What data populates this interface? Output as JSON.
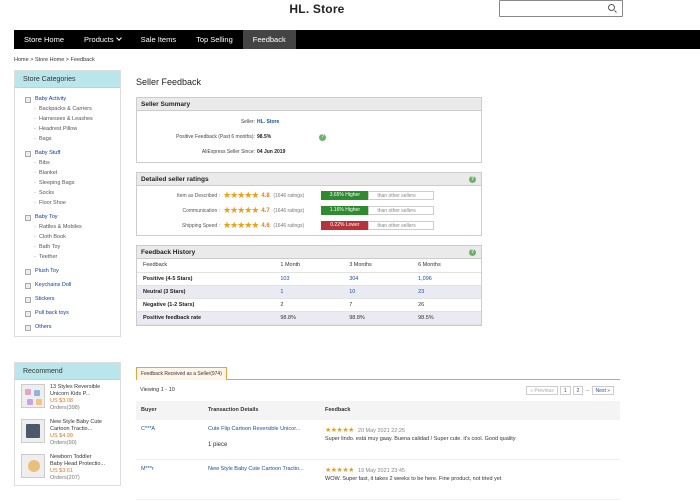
{
  "store": {
    "name": "HL. Store"
  },
  "search": {
    "placeholder": ""
  },
  "nav": {
    "items": [
      "Store Home",
      "Products",
      "Sale Items",
      "Top Selling",
      "Feedback"
    ]
  },
  "breadcrumb": "Home > Store Home > Feedback",
  "sidebar": {
    "title": "Store Categories",
    "items": [
      {
        "label": "Baby Activity",
        "level": "top"
      },
      {
        "label": "Backpacks & Carriers",
        "level": "sub"
      },
      {
        "label": "Harnesses & Leashes",
        "level": "sub"
      },
      {
        "label": "Headrest Pillow",
        "level": "sub"
      },
      {
        "label": "Bags",
        "level": "sub"
      },
      {
        "label": "Baby Stuff",
        "level": "top"
      },
      {
        "label": "Bibs",
        "level": "sub"
      },
      {
        "label": "Blanket",
        "level": "sub"
      },
      {
        "label": "Sleeping Bags",
        "level": "sub"
      },
      {
        "label": "Socks",
        "level": "sub"
      },
      {
        "label": "Floor Shoe",
        "level": "sub"
      },
      {
        "label": "Baby Toy",
        "level": "top"
      },
      {
        "label": "Rattles & Mobiles",
        "level": "sub"
      },
      {
        "label": "Cloth Book",
        "level": "sub"
      },
      {
        "label": "Bath Toy",
        "level": "sub"
      },
      {
        "label": "Teether",
        "level": "sub"
      },
      {
        "label": "Plush Toy",
        "level": "top"
      },
      {
        "label": "Keychains Doll",
        "level": "top"
      },
      {
        "label": "Stickers",
        "level": "top"
      },
      {
        "label": "Pull back toys",
        "level": "top"
      },
      {
        "label": "Others",
        "level": "top"
      }
    ]
  },
  "recommend": {
    "title": "Recommend",
    "items": [
      {
        "l1": "13 Styles Reversible",
        "l2": "Unicorn Kids P...",
        "price": "US $3.08",
        "orders": "Orders(398)"
      },
      {
        "l1": "New Style Baby Cute",
        "l2": "Cartoon Tractio...",
        "price": "US $4.99",
        "orders": "Orders(90)"
      },
      {
        "l1": "Newborn Toddler",
        "l2": "Baby Head Protectio...",
        "price": "US $3.61",
        "orders": "Orders(207)"
      }
    ]
  },
  "page_title": "Seller Feedback",
  "summary": {
    "title": "Seller Summary",
    "seller_label": "Seller:",
    "seller": "HL. Store",
    "positive_label": "Positive Feedback (Past 6 months):",
    "positive": "98.5%",
    "since_label": "AliExpress Seller Since:",
    "since": "04 Jun 2019"
  },
  "ratings": {
    "title": "Detailed seller ratings",
    "rows": [
      {
        "label": "Item as Described :",
        "score": "4.8",
        "count": "(1646 ratings)",
        "compare": "3.65% Higher",
        "other": "than other sellers",
        "color": "#2e8b2e",
        "stars": "★★★★★"
      },
      {
        "label": "Communication :",
        "score": "4.7",
        "count": "(1646 ratings)",
        "compare": "1.16% Higher",
        "other": "than other sellers",
        "color": "#2e8b2e",
        "stars": "★★★★★"
      },
      {
        "label": "Shipping Speed :",
        "score": "4.6",
        "count": "(1646 ratings)",
        "compare": "0.22% Lower",
        "other": "than other sellers",
        "color": "#b8323a",
        "stars": "★★★★★"
      }
    ]
  },
  "history": {
    "title": "Feedback History",
    "headers": [
      "Feedback",
      "1 Month",
      "3 Months",
      "6 Months"
    ],
    "rows": [
      {
        "label": "Positive (4-5 Stars)",
        "v": [
          "103",
          "304",
          "1,096"
        ],
        "link": true
      },
      {
        "label": "Neutral (3 Stars)",
        "v": [
          "1",
          "10",
          "23"
        ],
        "link": true
      },
      {
        "label": "Negative (1-2 Stars)",
        "v": [
          "2",
          "7",
          "26"
        ],
        "link": false
      },
      {
        "label": "Positive feedback rate",
        "v": [
          "98.8%",
          "98.8%",
          "98.5%"
        ],
        "link": false
      }
    ]
  },
  "received": {
    "tab": "Feedback Received as a Seller(974)",
    "viewing": "Viewing 1 - 10",
    "pager": {
      "prev": "« Previous",
      "p1": "1",
      "p2": "2",
      "dots": "...",
      "next": "Next »"
    },
    "headers": [
      "Buyer",
      "Transaction Details",
      "Feedback"
    ],
    "rows": [
      {
        "buyer": "C***A",
        "item": "Cute Flip Cartoon Reversible Unicor...",
        "qty": "1 piece",
        "stars": "★★★★★",
        "date": "20 May 2021 22:25",
        "text": "Super lindo. está muy gaay. Buena calidad / Super cute. it's cool. Good quality"
      },
      {
        "buyer": "M***r",
        "item": "New Style Baby Cute Cartoon Tractio...",
        "qty": "",
        "stars": "★★★★★",
        "date": "19 May 2021 23:45",
        "text": "WOW. Super fast, it takes 2 weeks to be here. Fine product, not tried yet"
      }
    ]
  }
}
